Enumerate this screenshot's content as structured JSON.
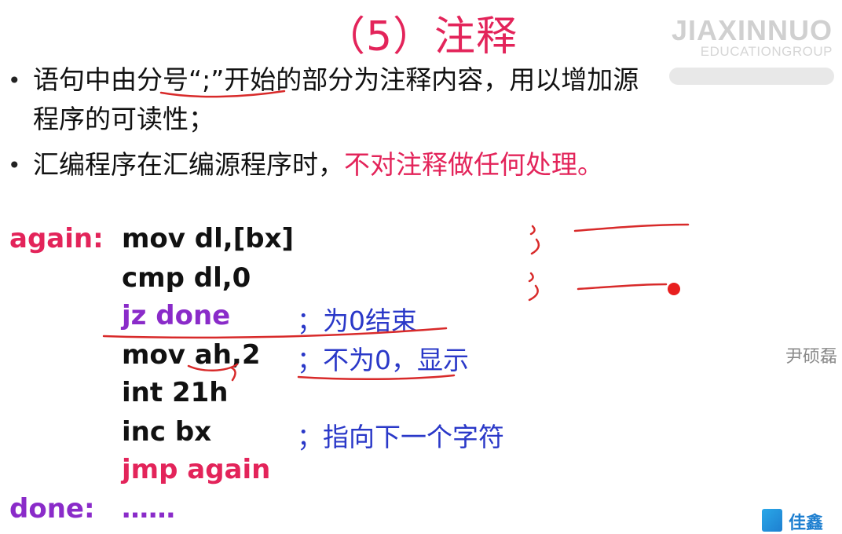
{
  "slide": {
    "title": "（5）注释",
    "watermark": {
      "line1": "JIAXINNUO",
      "line2": "EDUCATIONGROUP"
    },
    "bullets": [
      {
        "text_a": "语句中由分号“;”开始的部分为注释内容，用以增加源",
        "text_b": "程序的可读性；"
      },
      {
        "text_plain": "汇编程序在汇编源程序时，",
        "text_red": "不对注释做任何处理。"
      }
    ],
    "code": [
      {
        "label": "again:",
        "instr": "mov dl,[bx]",
        "comment": ""
      },
      {
        "label": "",
        "instr": "cmp dl,0",
        "comment": ""
      },
      {
        "label": "",
        "instr": "jz done",
        "comment": "；为0结束"
      },
      {
        "label": "",
        "instr": "mov ah,2",
        "comment": "；不为0，显示"
      },
      {
        "label": "",
        "instr": "int 21h",
        "comment": ""
      },
      {
        "label": "",
        "instr": "inc bx",
        "comment": "；指向下一个字符"
      },
      {
        "label": "",
        "instr": "jmp again",
        "comment": ""
      },
      {
        "label": "done:",
        "instr": "……",
        "comment": ""
      }
    ],
    "side_name": "尹硕磊",
    "logo_text": "佳鑫"
  },
  "colors": {
    "title": "#e3245a",
    "label": "#e3245a",
    "purple": "#8a2bc9",
    "comment": "#2a38c8",
    "ink": "#d82a2a"
  }
}
